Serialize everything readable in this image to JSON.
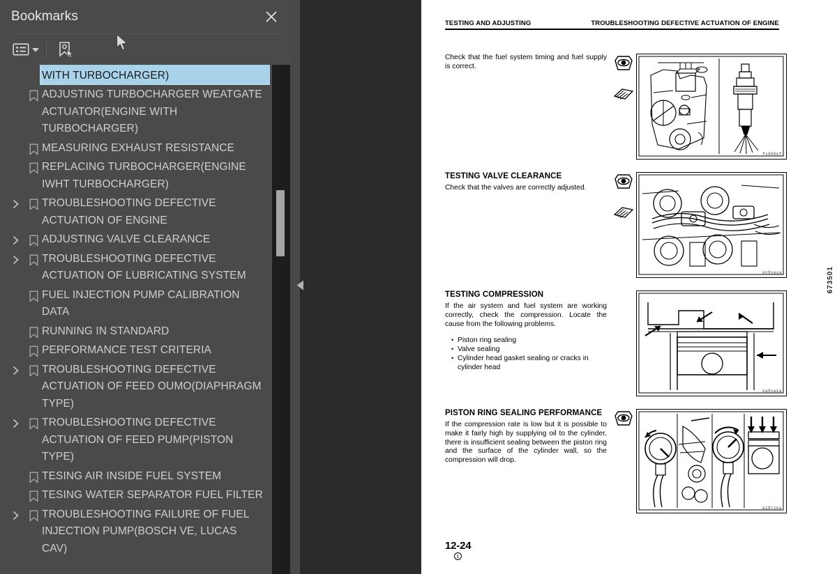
{
  "panel": {
    "title": "Bookmarks",
    "close_label": "×",
    "toolbar": {
      "options_icon": "list-options-icon",
      "caret_icon": "chevron-down-icon",
      "new_bookmark_icon": "new-bookmark-icon"
    },
    "collapse_handle_icon": "chevron-left-icon",
    "bookmarks": [
      {
        "label": "ACTUATOR BOOST CAPSULE(ENGINE WITH TURBOCHARGER)",
        "expandable": false,
        "selected": true
      },
      {
        "label": "ADJUSTING TURBOCHARGER WEATGATE ACTUATOR(ENGINE WITH TURBOCHARGER)",
        "expandable": false,
        "selected": false
      },
      {
        "label": "MEASURING EXHAUST RESISTANCE",
        "expandable": false,
        "selected": false
      },
      {
        "label": "REPLACING TURBOCHARGER(ENGINE IWHT TURBOCHARGER)",
        "expandable": false,
        "selected": false
      },
      {
        "label": "TROUBLESHOOTING DEFECTIVE ACTUATION OF ENGINE",
        "expandable": true,
        "selected": false
      },
      {
        "label": "ADJUSTING VALVE CLEARANCE",
        "expandable": true,
        "selected": false
      },
      {
        "label": "TROUBLESHOOTING DEFECTIVE ACTUATION OF LUBRICATING SYSTEM",
        "expandable": true,
        "selected": false
      },
      {
        "label": "FUEL INJECTION PUMP CALIBRATION DATA",
        "expandable": false,
        "selected": false
      },
      {
        "label": "RUNNING IN STANDARD",
        "expandable": false,
        "selected": false
      },
      {
        "label": "PERFORMANCE TEST CRITERIA",
        "expandable": false,
        "selected": false
      },
      {
        "label": "TROUBLESHOOTING DEFECTIVE ACTUATION OF FEED OUMO(DIAPHRAGM TYPE)",
        "expandable": true,
        "selected": false
      },
      {
        "label": "TROUBLESHOOTING DEFECTIVE ACTUATION OF FEED PUMP(PISTON TYPE)",
        "expandable": true,
        "selected": false
      },
      {
        "label": "TESING AIR INSIDE FUEL SYSTEM",
        "expandable": false,
        "selected": false
      },
      {
        "label": "TESING WATER SEPARATOR FUEL FILTER",
        "expandable": false,
        "selected": false
      },
      {
        "label": "TROUBLESHOOTING FAILURE OF FUEL INJECTION PUMP(BOSCH VE, LUCAS CAV)",
        "expandable": true,
        "selected": false
      }
    ]
  },
  "document": {
    "header_left": "TESTING AND ADJUSTING",
    "header_right": "TROUBLESHOOTING DEFECTIVE ACTUATION OF ENGINE",
    "sections": [
      {
        "heading": "",
        "body": "Check that the fuel system timing and fuel supply is correct.",
        "bullets": [],
        "figure_code": "fs900kf",
        "icons": [
          "eye-icon",
          "book-icon"
        ]
      },
      {
        "heading": "TESTING  VALVE CLEARANCE",
        "body": "Check that the valves are correctly adjusted.",
        "bullets": [],
        "figure_code": "kn9vaua",
        "icons": [
          "eye-icon",
          "book-icon"
        ]
      },
      {
        "heading": "TESTING COMPRESSION",
        "body": "If the air system and fuel system are working correctly, check the compression.  Locate the cause from the following problems.",
        "bullets": [
          "Piston ring sealing",
          "Valve sealing",
          "Cylinder head gasket sealing or cracks in cylinder head"
        ],
        "figure_code": "ka9vaka",
        "icons": []
      },
      {
        "heading": "PISTON RING SEALING PERFORMANCE",
        "body": "If the compression rate is low but it is possible to make it fairly high by supplying oil to the cylinder, there is insufficient sealing between the piston ring and the surface of the cylinder wall, so the compression will drop.",
        "bullets": [],
        "figure_code": "ai9rika",
        "icons": [
          "eye-icon"
        ]
      }
    ],
    "vertical_code": "673501",
    "page_number": "12-24",
    "page_note": "1"
  },
  "colors": {
    "panel_bg": "#4a4a4a",
    "app_bg": "#2b2b2b",
    "selection": "#a9d3ea",
    "text": "#cfcfcf",
    "scrollbar_thumb": "#a6a6a6",
    "page_bg": "#ffffff"
  }
}
